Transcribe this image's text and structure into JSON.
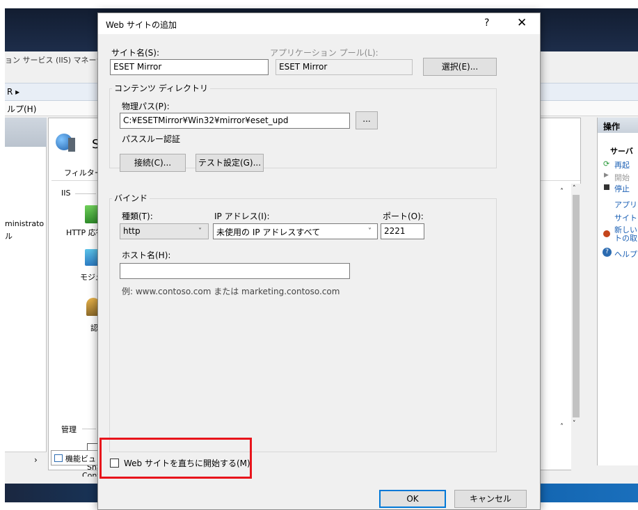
{
  "background_window": {
    "title": "ョン サービス (IIS) マネージャ",
    "address": "R ▸",
    "menu": "ルプ(H)",
    "left_items": [
      "ministrato",
      "ル"
    ],
    "center": {
      "site_icon_letter": "S",
      "filter_label": "フィルター:",
      "group_iis": "IIS",
      "http_label": "HTTP 応答",
      "module_label": "モジュ",
      "auth_label": "認証",
      "group_manage": "管理",
      "shared_label": "Shar",
      "config_label": "Configu",
      "features_view_tab": "機能ビュ"
    },
    "right_pane": {
      "header": "操作",
      "server_label": "サーバ",
      "restart": "再起",
      "start": "開始",
      "stop": "停止",
      "app_pool": "アプリ",
      "sites": "サイト",
      "new_site_1": "新しい",
      "new_site_2": "トの取",
      "help": "ヘルプ"
    }
  },
  "dialog": {
    "title": "Web サイトの追加",
    "help_glyph": "?",
    "close_glyph": "✕",
    "site_name_label": "サイト名(S):",
    "site_name_value": "ESET Mirror",
    "app_pool_label": "アプリケーション プール(L):",
    "app_pool_value": "ESET Mirror",
    "select_button": "選択(E)...",
    "content_dir_group": "コンテンツ ディレクトリ",
    "physical_path_label": "物理パス(P):",
    "physical_path_value": "C:¥ESETMirror¥Win32¥mirror¥eset_upd",
    "browse_button": "...",
    "passthrough_label": "パススルー認証",
    "connect_as_button": "接続(C)...",
    "test_settings_button": "テスト設定(G)...",
    "binding_group": "バインド",
    "type_label": "種類(T):",
    "type_value": "http",
    "ip_label": "IP アドレス(I):",
    "ip_value": "未使用の IP アドレスすべて",
    "port_label": "ポート(O):",
    "port_value": "2221",
    "host_label": "ホスト名(H):",
    "host_value": "",
    "example_text": "例: www.contoso.com または marketing.contoso.com",
    "start_now_label": "Web サイトを直ちに開始する(M)",
    "start_now_checked": false,
    "ok_button": "OK",
    "cancel_button": "キャンセル"
  },
  "colors": {
    "highlight": "#e8141b",
    "dialog_bg": "#f0f0f0",
    "accent": "#0078d7"
  }
}
